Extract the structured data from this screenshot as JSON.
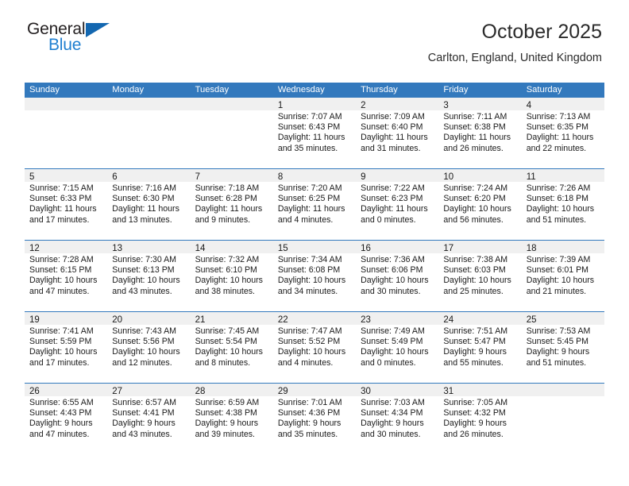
{
  "brand": {
    "name_top": "General",
    "name_bottom": "Blue",
    "accent_color": "#1f7fd0",
    "triangle_color": "#1367b0"
  },
  "header": {
    "title": "October 2025",
    "subtitle": "Carlton, England, United Kingdom"
  },
  "theme": {
    "header_row_bg": "#3379bd",
    "day_band_bg": "#f0f0f0",
    "text_color": "#1a1a1a",
    "page_bg": "#ffffff"
  },
  "weekdays": [
    "Sunday",
    "Monday",
    "Tuesday",
    "Wednesday",
    "Thursday",
    "Friday",
    "Saturday"
  ],
  "weeks": [
    [
      {
        "day": "",
        "sunrise": "",
        "sunset": "",
        "daylight": "",
        "empty": true
      },
      {
        "day": "",
        "sunrise": "",
        "sunset": "",
        "daylight": "",
        "empty": true
      },
      {
        "day": "",
        "sunrise": "",
        "sunset": "",
        "daylight": "",
        "empty": true
      },
      {
        "day": "1",
        "sunrise": "Sunrise: 7:07 AM",
        "sunset": "Sunset: 6:43 PM",
        "daylight": "Daylight: 11 hours and 35 minutes."
      },
      {
        "day": "2",
        "sunrise": "Sunrise: 7:09 AM",
        "sunset": "Sunset: 6:40 PM",
        "daylight": "Daylight: 11 hours and 31 minutes."
      },
      {
        "day": "3",
        "sunrise": "Sunrise: 7:11 AM",
        "sunset": "Sunset: 6:38 PM",
        "daylight": "Daylight: 11 hours and 26 minutes."
      },
      {
        "day": "4",
        "sunrise": "Sunrise: 7:13 AM",
        "sunset": "Sunset: 6:35 PM",
        "daylight": "Daylight: 11 hours and 22 minutes."
      }
    ],
    [
      {
        "day": "5",
        "sunrise": "Sunrise: 7:15 AM",
        "sunset": "Sunset: 6:33 PM",
        "daylight": "Daylight: 11 hours and 17 minutes."
      },
      {
        "day": "6",
        "sunrise": "Sunrise: 7:16 AM",
        "sunset": "Sunset: 6:30 PM",
        "daylight": "Daylight: 11 hours and 13 minutes."
      },
      {
        "day": "7",
        "sunrise": "Sunrise: 7:18 AM",
        "sunset": "Sunset: 6:28 PM",
        "daylight": "Daylight: 11 hours and 9 minutes."
      },
      {
        "day": "8",
        "sunrise": "Sunrise: 7:20 AM",
        "sunset": "Sunset: 6:25 PM",
        "daylight": "Daylight: 11 hours and 4 minutes."
      },
      {
        "day": "9",
        "sunrise": "Sunrise: 7:22 AM",
        "sunset": "Sunset: 6:23 PM",
        "daylight": "Daylight: 11 hours and 0 minutes."
      },
      {
        "day": "10",
        "sunrise": "Sunrise: 7:24 AM",
        "sunset": "Sunset: 6:20 PM",
        "daylight": "Daylight: 10 hours and 56 minutes."
      },
      {
        "day": "11",
        "sunrise": "Sunrise: 7:26 AM",
        "sunset": "Sunset: 6:18 PM",
        "daylight": "Daylight: 10 hours and 51 minutes."
      }
    ],
    [
      {
        "day": "12",
        "sunrise": "Sunrise: 7:28 AM",
        "sunset": "Sunset: 6:15 PM",
        "daylight": "Daylight: 10 hours and 47 minutes."
      },
      {
        "day": "13",
        "sunrise": "Sunrise: 7:30 AM",
        "sunset": "Sunset: 6:13 PM",
        "daylight": "Daylight: 10 hours and 43 minutes."
      },
      {
        "day": "14",
        "sunrise": "Sunrise: 7:32 AM",
        "sunset": "Sunset: 6:10 PM",
        "daylight": "Daylight: 10 hours and 38 minutes."
      },
      {
        "day": "15",
        "sunrise": "Sunrise: 7:34 AM",
        "sunset": "Sunset: 6:08 PM",
        "daylight": "Daylight: 10 hours and 34 minutes."
      },
      {
        "day": "16",
        "sunrise": "Sunrise: 7:36 AM",
        "sunset": "Sunset: 6:06 PM",
        "daylight": "Daylight: 10 hours and 30 minutes."
      },
      {
        "day": "17",
        "sunrise": "Sunrise: 7:38 AM",
        "sunset": "Sunset: 6:03 PM",
        "daylight": "Daylight: 10 hours and 25 minutes."
      },
      {
        "day": "18",
        "sunrise": "Sunrise: 7:39 AM",
        "sunset": "Sunset: 6:01 PM",
        "daylight": "Daylight: 10 hours and 21 minutes."
      }
    ],
    [
      {
        "day": "19",
        "sunrise": "Sunrise: 7:41 AM",
        "sunset": "Sunset: 5:59 PM",
        "daylight": "Daylight: 10 hours and 17 minutes."
      },
      {
        "day": "20",
        "sunrise": "Sunrise: 7:43 AM",
        "sunset": "Sunset: 5:56 PM",
        "daylight": "Daylight: 10 hours and 12 minutes."
      },
      {
        "day": "21",
        "sunrise": "Sunrise: 7:45 AM",
        "sunset": "Sunset: 5:54 PM",
        "daylight": "Daylight: 10 hours and 8 minutes."
      },
      {
        "day": "22",
        "sunrise": "Sunrise: 7:47 AM",
        "sunset": "Sunset: 5:52 PM",
        "daylight": "Daylight: 10 hours and 4 minutes."
      },
      {
        "day": "23",
        "sunrise": "Sunrise: 7:49 AM",
        "sunset": "Sunset: 5:49 PM",
        "daylight": "Daylight: 10 hours and 0 minutes."
      },
      {
        "day": "24",
        "sunrise": "Sunrise: 7:51 AM",
        "sunset": "Sunset: 5:47 PM",
        "daylight": "Daylight: 9 hours and 55 minutes."
      },
      {
        "day": "25",
        "sunrise": "Sunrise: 7:53 AM",
        "sunset": "Sunset: 5:45 PM",
        "daylight": "Daylight: 9 hours and 51 minutes."
      }
    ],
    [
      {
        "day": "26",
        "sunrise": "Sunrise: 6:55 AM",
        "sunset": "Sunset: 4:43 PM",
        "daylight": "Daylight: 9 hours and 47 minutes."
      },
      {
        "day": "27",
        "sunrise": "Sunrise: 6:57 AM",
        "sunset": "Sunset: 4:41 PM",
        "daylight": "Daylight: 9 hours and 43 minutes."
      },
      {
        "day": "28",
        "sunrise": "Sunrise: 6:59 AM",
        "sunset": "Sunset: 4:38 PM",
        "daylight": "Daylight: 9 hours and 39 minutes."
      },
      {
        "day": "29",
        "sunrise": "Sunrise: 7:01 AM",
        "sunset": "Sunset: 4:36 PM",
        "daylight": "Daylight: 9 hours and 35 minutes."
      },
      {
        "day": "30",
        "sunrise": "Sunrise: 7:03 AM",
        "sunset": "Sunset: 4:34 PM",
        "daylight": "Daylight: 9 hours and 30 minutes."
      },
      {
        "day": "31",
        "sunrise": "Sunrise: 7:05 AM",
        "sunset": "Sunset: 4:32 PM",
        "daylight": "Daylight: 9 hours and 26 minutes."
      },
      {
        "day": "",
        "sunrise": "",
        "sunset": "",
        "daylight": "",
        "empty": true
      }
    ]
  ]
}
